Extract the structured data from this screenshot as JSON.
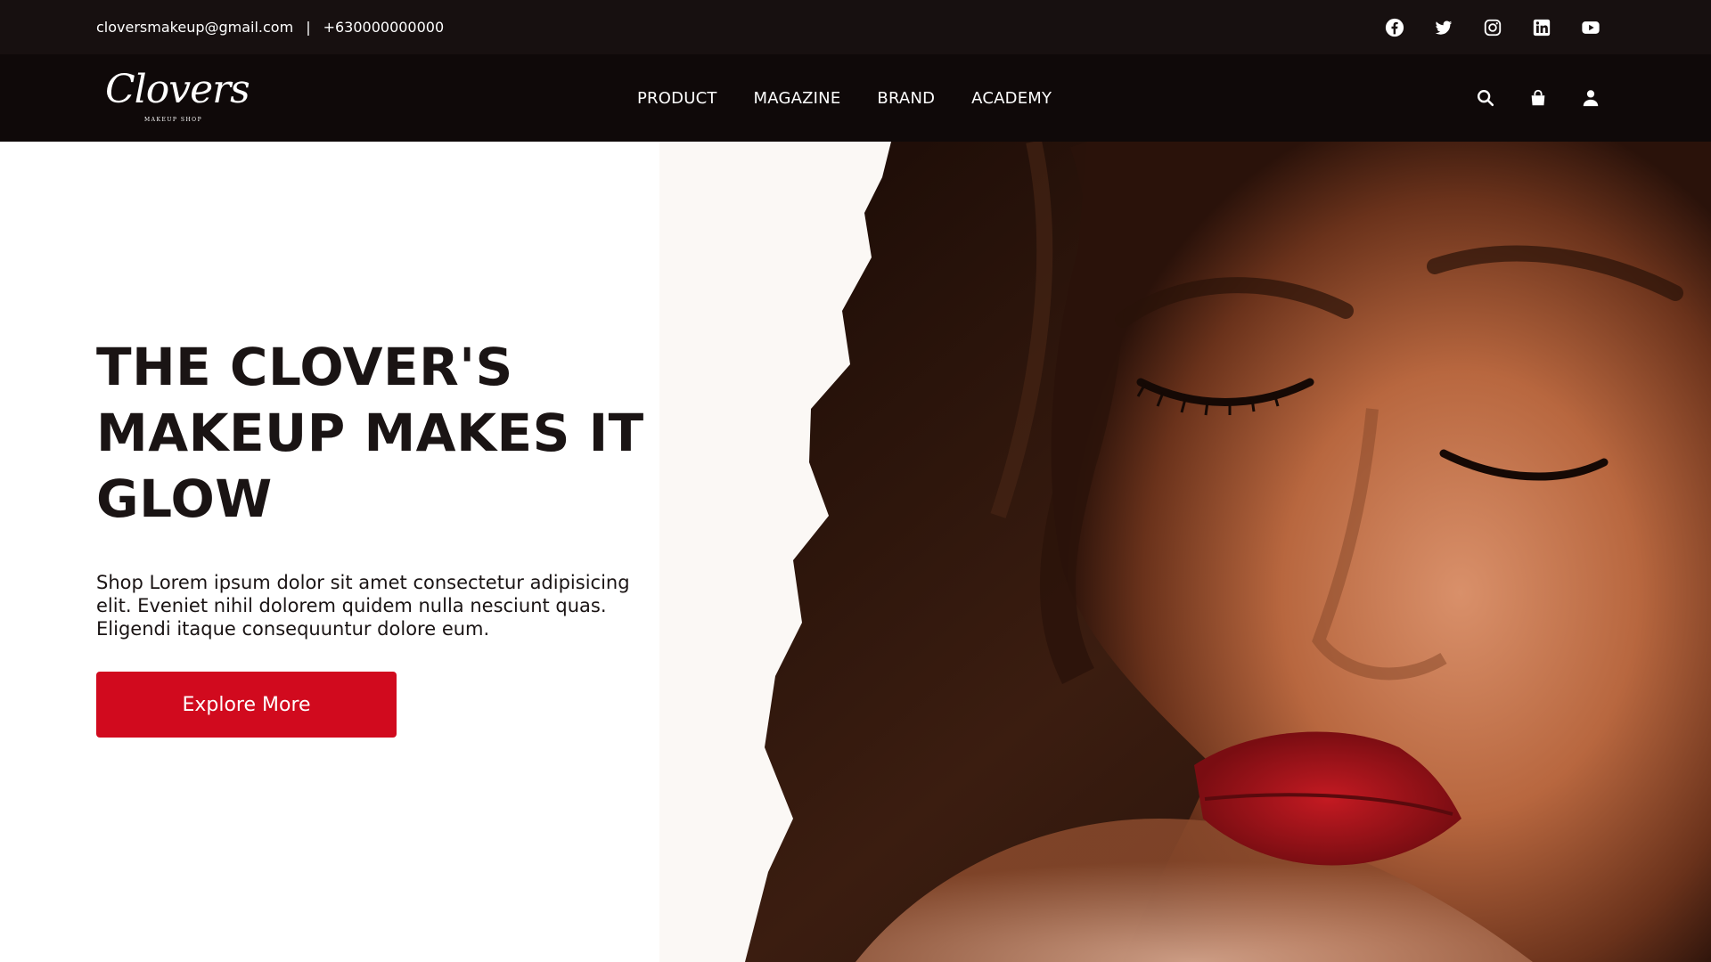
{
  "topbar": {
    "email": "cloversmakeup@gmail.com",
    "separator": "|",
    "phone": "+630000000000",
    "social_icons": [
      "facebook-icon",
      "twitter-icon",
      "instagram-icon",
      "linkedin-icon",
      "youtube-icon"
    ]
  },
  "brand": {
    "name": "Clovers",
    "tagline": "MAKEUP SHOP"
  },
  "nav": {
    "items": [
      "PRODUCT",
      "MAGAZINE",
      "BRAND",
      "ACADEMY"
    ],
    "action_icons": [
      "search-icon",
      "shopping-bag-icon",
      "user-icon"
    ]
  },
  "hero": {
    "headline": "THE CLOVER'S MAKEUP MAKES IT GLOW",
    "subtext": "Shop Lorem ipsum dolor sit amet consectetur adipisicing elit. Eveniet nihil dolorem quidem nulla nesciunt quas. Eligendi itaque consequuntur dolore eum.",
    "cta_label": "Explore More"
  },
  "colors": {
    "topbar_bg": "#171010",
    "navbar_bg": "#0f0909",
    "accent": "#d10a1e",
    "text_dark": "#1a1414",
    "lips": "#a4121c"
  }
}
